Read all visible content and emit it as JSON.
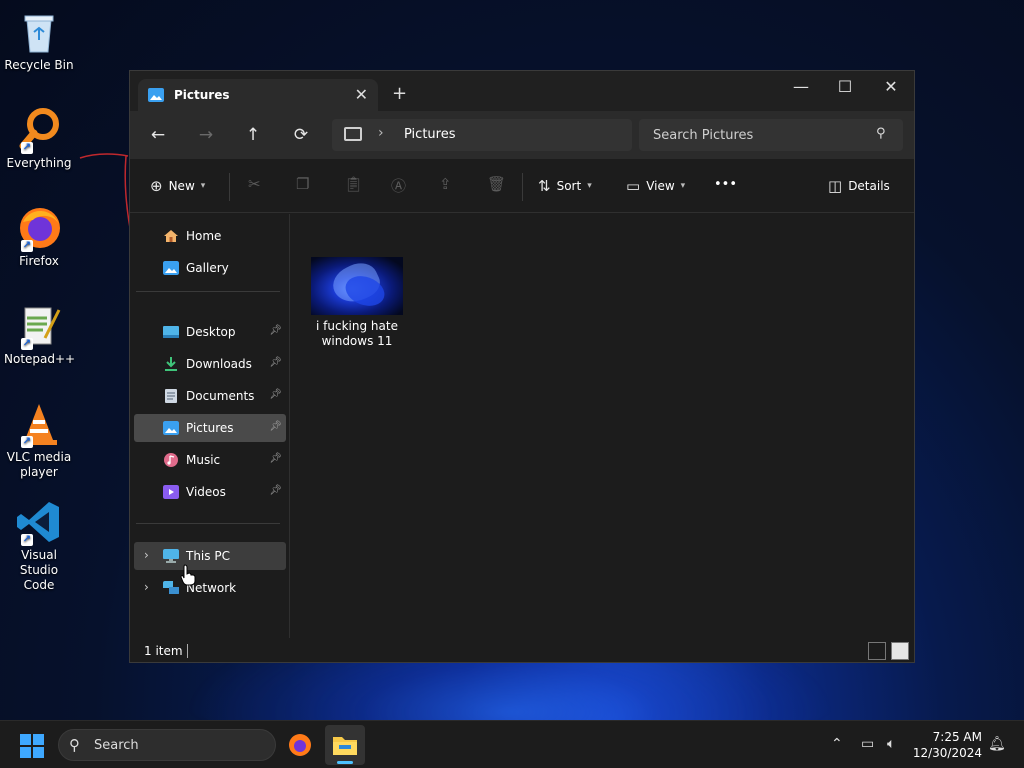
{
  "desktop": {
    "icons": [
      {
        "label": "Recycle Bin"
      },
      {
        "label": "Everything"
      },
      {
        "label": "Firefox"
      },
      {
        "label": "Notepad++"
      },
      {
        "label": "VLC media player"
      },
      {
        "label": "Visual Studio Code"
      }
    ]
  },
  "window": {
    "tab_title": "Pictures",
    "new_tab_glyph": "+",
    "controls": {
      "minimize": "—",
      "maximize": "☐",
      "close": "✕"
    },
    "address": {
      "crumb": "Pictures"
    },
    "search": {
      "placeholder": "Search Pictures"
    },
    "toolbar": {
      "new_label": "New",
      "sort_label": "Sort",
      "view_label": "View",
      "more_glyph": "•••",
      "details_label": "Details"
    },
    "sidebar": {
      "top": [
        {
          "label": "Home"
        },
        {
          "label": "Gallery"
        }
      ],
      "quick": [
        {
          "label": "Desktop"
        },
        {
          "label": "Downloads"
        },
        {
          "label": "Documents"
        },
        {
          "label": "Pictures"
        },
        {
          "label": "Music"
        },
        {
          "label": "Videos"
        }
      ],
      "devices": [
        {
          "label": "This PC"
        },
        {
          "label": "Network"
        }
      ]
    },
    "files": [
      {
        "name": "i fucking hate windows 11"
      }
    ],
    "status": {
      "count": "1 item"
    }
  },
  "taskbar": {
    "search_label": "Search",
    "time": "7:25 AM",
    "date": "12/30/2024"
  },
  "colors": {
    "accent": "#4cc2ff",
    "window_bg": "#1c1c1c",
    "selected": "#4a4a4a"
  }
}
